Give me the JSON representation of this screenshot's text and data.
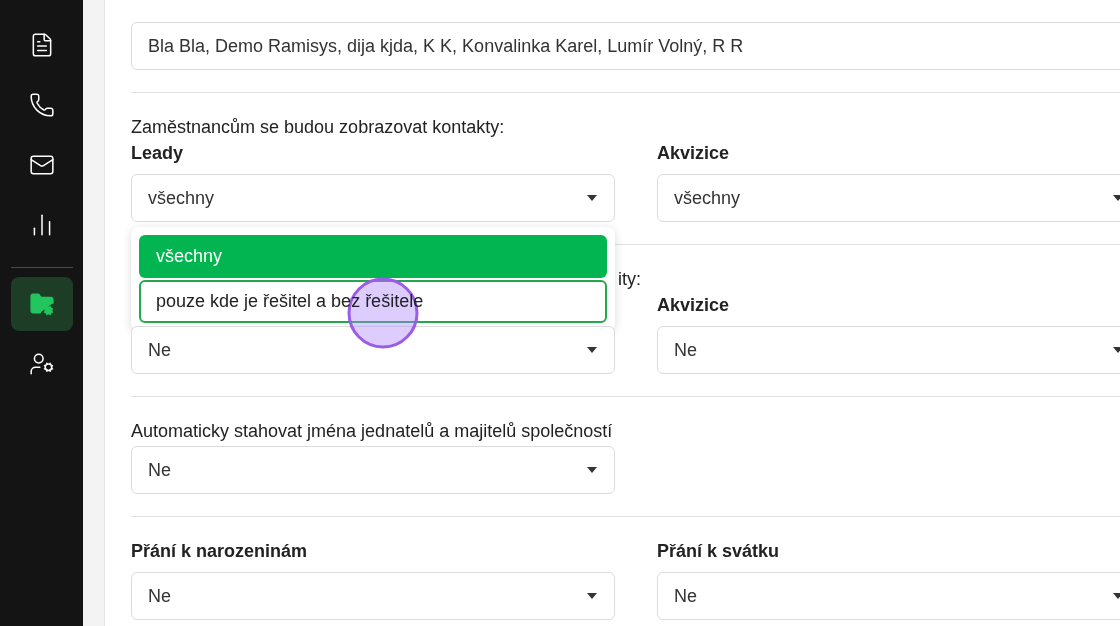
{
  "sidebar": {
    "items": [
      {
        "kind": "document",
        "selected": false
      },
      {
        "kind": "phone",
        "selected": false
      },
      {
        "kind": "mail",
        "selected": false
      },
      {
        "kind": "chart",
        "selected": false
      },
      {
        "kind": "divider"
      },
      {
        "kind": "folder-settings",
        "selected": true
      },
      {
        "kind": "user-settings",
        "selected": false
      }
    ]
  },
  "employees": {
    "value": "Bla Bla, Demo Ramisys, dija kjda, K K, Konvalinka Karel, Lumír Volný, R R"
  },
  "sections": [
    {
      "caption": "Zaměstnancům se budou zobrazovat kontakty:",
      "fields": [
        {
          "label": "Leady",
          "value": "všechny",
          "options": [
            {
              "label": "všechny",
              "selected": true,
              "focused": false
            },
            {
              "label": "pouze kde je řešitel a bez řešitele",
              "selected": false,
              "focused": true
            }
          ]
        },
        {
          "label": "Akvizice",
          "value": "všechny"
        }
      ]
    },
    {
      "caption": "ity:",
      "fields": [
        {
          "value": "Ne"
        },
        {
          "label": "Akvizice",
          "value": "Ne"
        }
      ]
    },
    {
      "caption": "Automaticky stahovat jména jednatelů a majitelů společností",
      "fields": [
        {
          "value": "Ne"
        }
      ]
    },
    {
      "fields": [
        {
          "label": "Přání k narozeninám",
          "value": "Ne"
        },
        {
          "label": "Přání k svátku",
          "value": "Ne"
        }
      ]
    }
  ]
}
